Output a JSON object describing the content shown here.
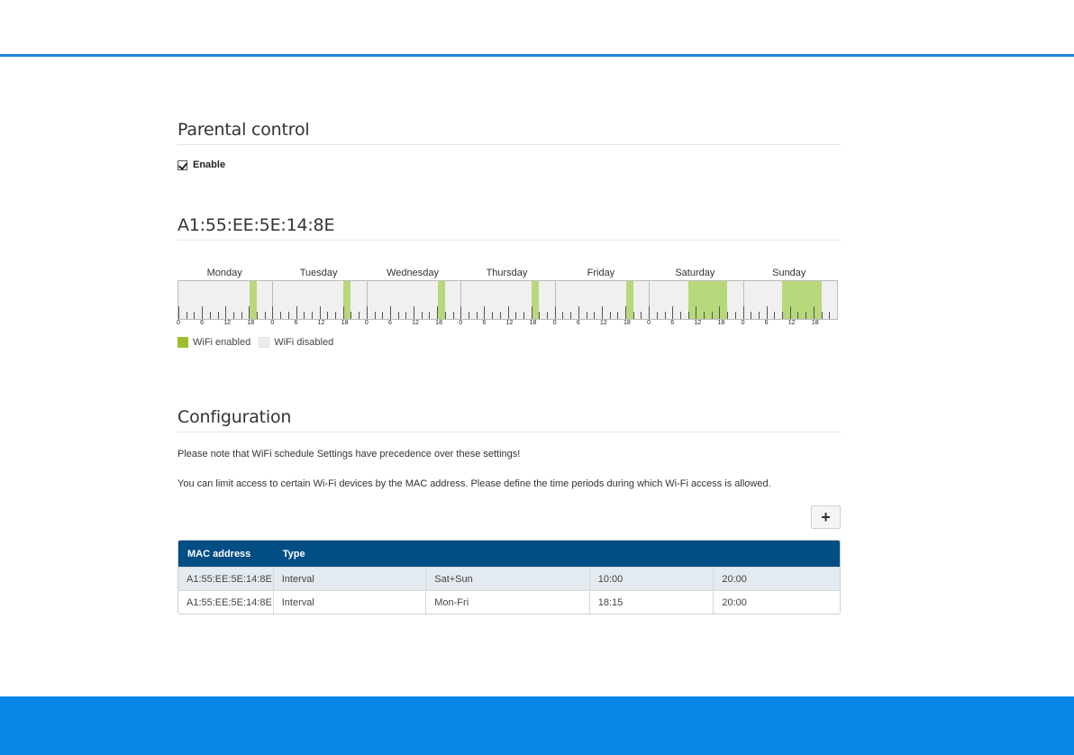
{
  "parental": {
    "title": "Parental control",
    "enable_label": "Enable",
    "enable_checked": true
  },
  "device": {
    "title": "A1:55:EE:5E:14:8E"
  },
  "schedule": {
    "days": [
      {
        "label": "Monday",
        "enabled": [
          [
            18.15,
            20
          ]
        ]
      },
      {
        "label": "Tuesday",
        "enabled": [
          [
            18.15,
            20
          ]
        ]
      },
      {
        "label": "Wednesday",
        "enabled": [
          [
            18.15,
            20
          ]
        ]
      },
      {
        "label": "Thursday",
        "enabled": [
          [
            18.15,
            20
          ]
        ]
      },
      {
        "label": "Friday",
        "enabled": [
          [
            18.15,
            20
          ]
        ]
      },
      {
        "label": "Saturday",
        "enabled": [
          [
            10,
            20
          ]
        ]
      },
      {
        "label": "Sunday",
        "enabled": [
          [
            10,
            20
          ]
        ]
      }
    ],
    "tick_labels": [
      "0",
      "6",
      "12",
      "18"
    ],
    "enabled_color": "#b8d87c",
    "disabled_color": "#f0f0f0"
  },
  "legend": {
    "enabled_label": "WiFi enabled",
    "disabled_label": "WiFi disabled",
    "enabled_swatch": "#9cbf2b",
    "disabled_swatch": "#eeeeee"
  },
  "config": {
    "title": "Configuration",
    "note1": "Please note that WiFi schedule Settings have precedence over these settings!",
    "note2": "You can limit access to certain Wi-Fi devices by the MAC address. Please define the time periods during which Wi-Fi access is allowed.",
    "add_label": "+"
  },
  "table": {
    "headers": [
      "MAC address",
      "Type"
    ],
    "rows": [
      {
        "mac": "A1:55:EE:5E:14:8E",
        "type": "Interval",
        "days": "Sat+Sun",
        "start": "10:00",
        "end": "20:00"
      },
      {
        "mac": "A1:55:EE:5E:14:8E",
        "type": "Interval",
        "days": "Mon-Fri",
        "start": "18:15",
        "end": "20:00"
      }
    ]
  }
}
